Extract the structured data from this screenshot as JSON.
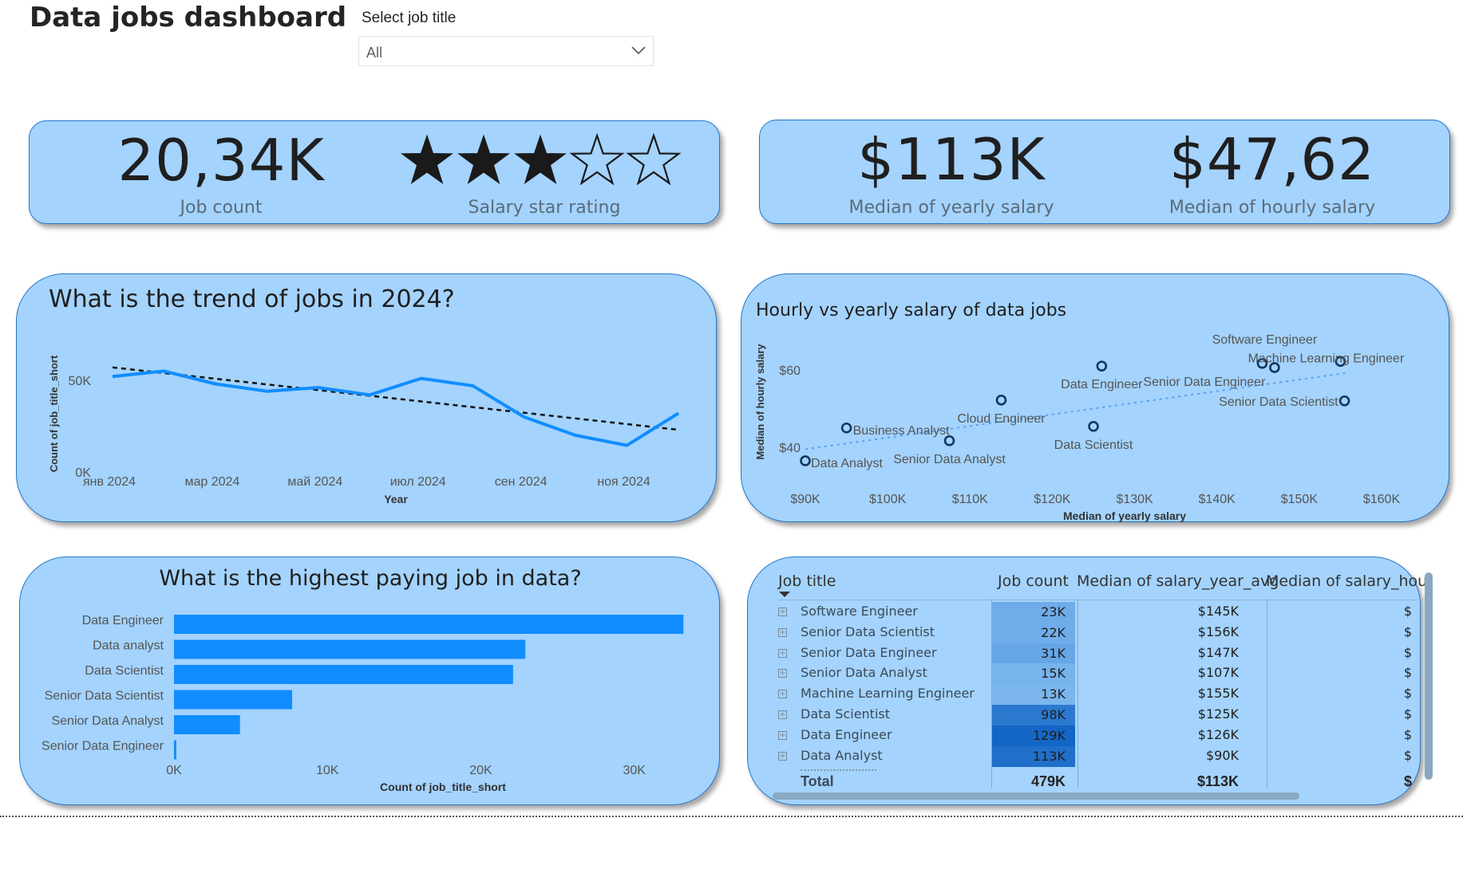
{
  "header": {
    "title": "Data jobs dashboard"
  },
  "slicer": {
    "label": "Select job title",
    "value": "All"
  },
  "kpi": {
    "job_count": "20,34K",
    "job_count_label": "Job count",
    "star_label": "Salary star rating",
    "stars_filled": 3,
    "stars_total": 5,
    "median_yearly": "$113K",
    "median_yearly_label": "Median of yearly salary",
    "median_hourly": "$47,62",
    "median_hourly_label": "Median of hourly salary"
  },
  "colors": {
    "card_bg": "#a4d3fd",
    "card_border": "#2276c9",
    "series": "#118dff",
    "heat_dark": "#1366c6"
  },
  "chart_data": [
    {
      "type": "line",
      "title": "What is the trend of jobs in 2024?",
      "xlabel": "Year",
      "ylabel": "Count of job_title_short",
      "x_ticks": [
        "янв 2024",
        "мар 2024",
        "май 2024",
        "июл 2024",
        "сен 2024",
        "ноя 2024"
      ],
      "y_ticks": [
        "0K",
        "50K"
      ],
      "ylim": [
        0,
        63000
      ],
      "x": [
        0,
        1,
        2,
        3,
        4,
        5,
        6,
        7,
        8,
        9,
        10,
        11
      ],
      "values": [
        52000,
        55000,
        48000,
        44000,
        46000,
        42000,
        51000,
        47000,
        30000,
        20000,
        14500,
        32000
      ],
      "trend": {
        "start": 57000,
        "end": 23000
      },
      "grid": false
    },
    {
      "type": "scatter",
      "title": "Hourly vs yearly salary of data jobs",
      "xlabel": "Median of yearly salary",
      "ylabel": "Median of hourly salary",
      "x_ticks": [
        "$90K",
        "$100K",
        "$110K",
        "$120K",
        "$130K",
        "$140K",
        "$150K",
        "$160K"
      ],
      "y_ticks": [
        "$40",
        "$60"
      ],
      "xlim": [
        90000,
        160000
      ],
      "ylim": [
        33000,
        70000
      ],
      "points": [
        {
          "label": "Data Analyst",
          "x": 90000,
          "y": 36.5
        },
        {
          "label": "Business Analyst",
          "x": 95000,
          "y": 45.0
        },
        {
          "label": "Senior Data Analyst",
          "x": 107500,
          "y": 41.7
        },
        {
          "label": "Cloud Engineer",
          "x": 113800,
          "y": 52.2
        },
        {
          "label": "Data Scientist",
          "x": 125000,
          "y": 45.4
        },
        {
          "label": "Data Engineer",
          "x": 126000,
          "y": 61.0
        },
        {
          "label": "Senior Data Engineer",
          "x": 147000,
          "y": 60.6
        },
        {
          "label": "Software Engineer",
          "x": 145500,
          "y": 61.7
        },
        {
          "label": "Machine Learning Engineer",
          "x": 155000,
          "y": 62.2
        },
        {
          "label": "Senior Data Scientist",
          "x": 155500,
          "y": 52.0
        }
      ]
    },
    {
      "type": "bar",
      "title": "What is the highest paying job in data?",
      "xlabel": "Count of job_title_short",
      "x_ticks": [
        "0K",
        "10K",
        "20K",
        "30K"
      ],
      "xlim": [
        0,
        33500
      ],
      "categories": [
        "Data Engineer",
        "Data analyst",
        "Data Scientist",
        "Senior Data Scientist",
        "Senior Data Analyst",
        "Senior Data Engineer"
      ],
      "values": [
        33200,
        22900,
        22100,
        7700,
        4300,
        150
      ]
    }
  ],
  "table": {
    "headers": [
      "Job title",
      "Job count",
      "Median of salary_year_avg",
      "Median of salary_hour_a"
    ],
    "rows": [
      {
        "title": "Software Engineer",
        "count": "23K",
        "count_raw": 23,
        "salary": "$145K",
        "hour": "$"
      },
      {
        "title": "Senior Data Scientist",
        "count": "22K",
        "count_raw": 22,
        "salary": "$156K",
        "hour": "$"
      },
      {
        "title": "Senior Data Engineer",
        "count": "31K",
        "count_raw": 31,
        "salary": "$147K",
        "hour": "$"
      },
      {
        "title": "Senior Data Analyst",
        "count": "15K",
        "count_raw": 15,
        "salary": "$107K",
        "hour": "$"
      },
      {
        "title": "Machine Learning Engineer",
        "count": "13K",
        "count_raw": 13,
        "salary": "$155K",
        "hour": "$"
      },
      {
        "title": "Data Scientist",
        "count": "98K",
        "count_raw": 98,
        "salary": "$125K",
        "hour": "$"
      },
      {
        "title": "Data Engineer",
        "count": "129K",
        "count_raw": 129,
        "salary": "$126K",
        "hour": "$"
      },
      {
        "title": "Data Analyst",
        "count": "113K",
        "count_raw": 113,
        "salary": "$90K",
        "hour": "$"
      }
    ],
    "total": {
      "title": "Total",
      "count": "479K",
      "salary": "$113K",
      "hour": "$"
    }
  }
}
